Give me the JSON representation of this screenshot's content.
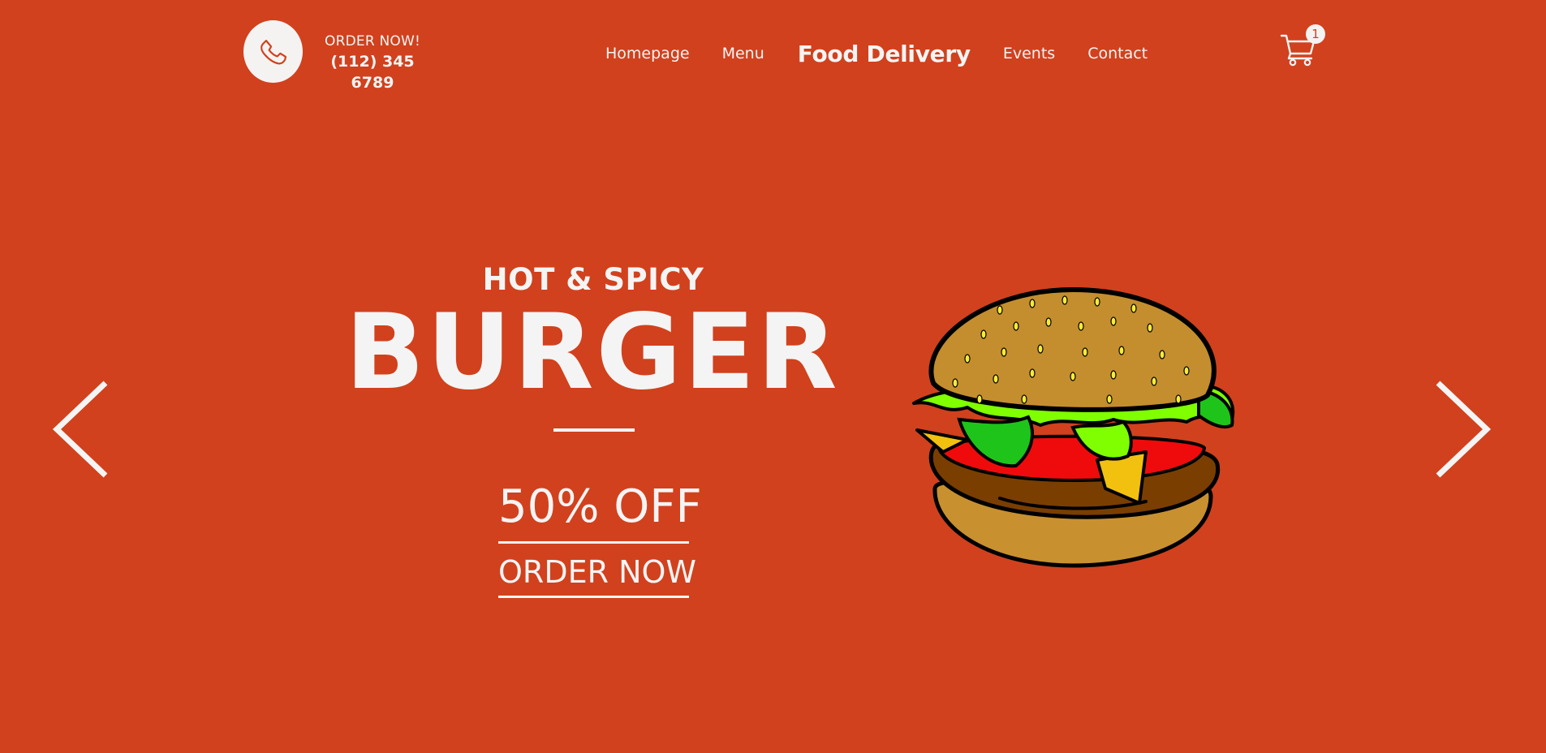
{
  "header": {
    "order_label": "ORDER NOW!",
    "phone_number": "(112) 345 6789",
    "icons": {
      "phone": "phone-icon",
      "cart": "cart-icon"
    },
    "nav": [
      {
        "label": "Homepage"
      },
      {
        "label": "Menu"
      },
      {
        "label": "Food Delivery"
      },
      {
        "label": "Events"
      },
      {
        "label": "Contact"
      }
    ],
    "cart_count": "1"
  },
  "hero": {
    "kicker": "HOT & SPICY",
    "title": "BURGER",
    "promo": "50% OFF",
    "cta": "ORDER NOW",
    "image": "burger-illustration"
  },
  "slider": {
    "prev_icon": "chevron-left-icon",
    "next_icon": "chevron-right-icon"
  },
  "colors": {
    "background": "#d1411d",
    "text": "#f4f4f4",
    "circle": "#f5f3f2"
  }
}
